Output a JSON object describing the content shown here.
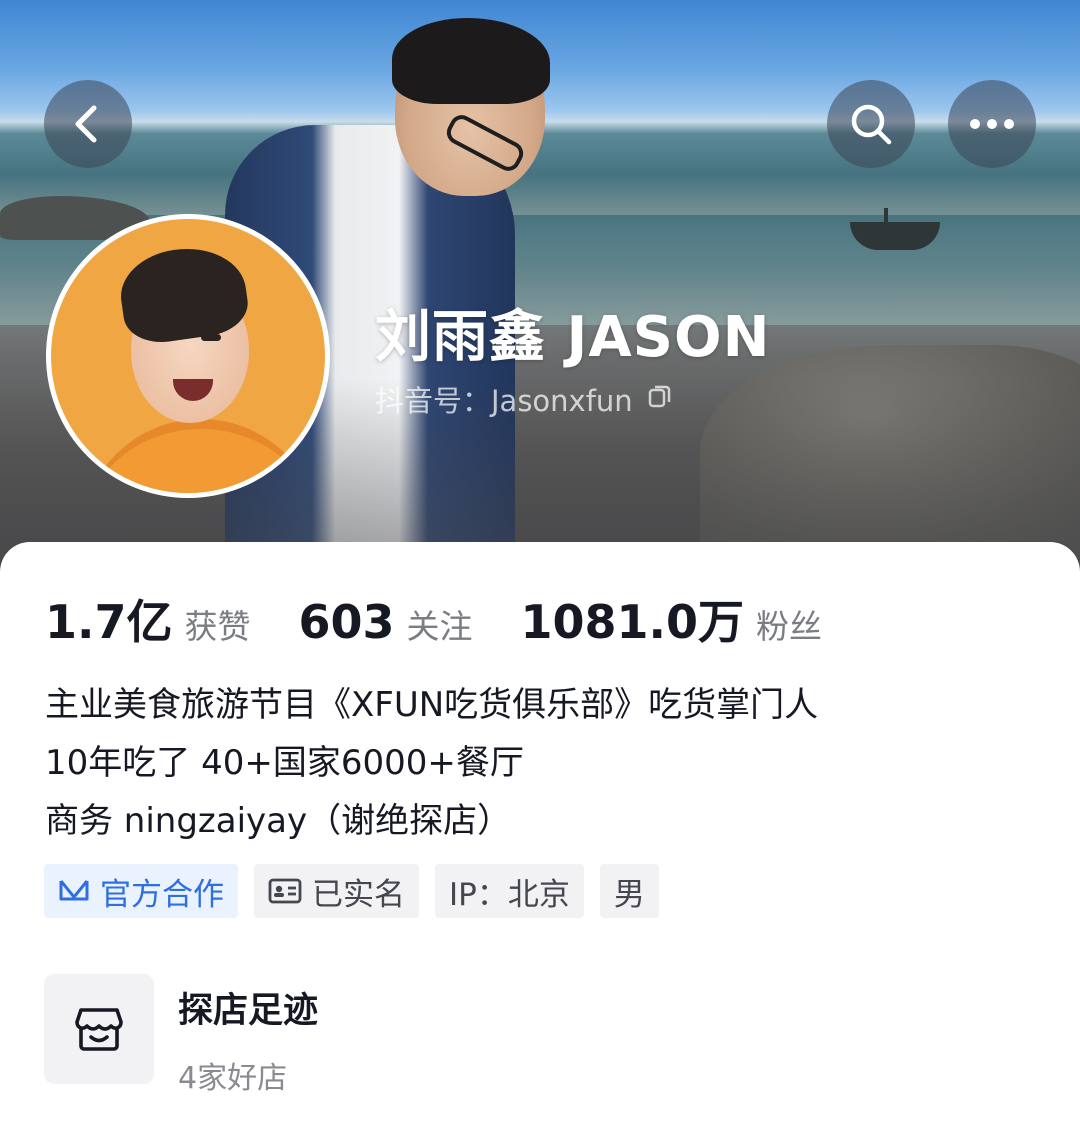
{
  "header": {
    "name": "刘雨鑫 JASON",
    "douyin_id": "抖音号：Jasonxfun",
    "back_icon": "chevron-left-icon",
    "search_icon": "search-icon",
    "more_icon": "more-horizontal-icon"
  },
  "stats": [
    {
      "value": "1.7亿",
      "label": "获赞"
    },
    {
      "value": "603",
      "label": "关注"
    },
    {
      "value": "1081.0万",
      "label": "粉丝"
    }
  ],
  "bio": [
    "主业美食旅游节目《XFUN吃货俱乐部》吃货掌门人",
    "10年吃了 40+国家6000+餐厅",
    "商务 ningzaiyay（谢绝探店）"
  ],
  "tags": {
    "official": "官方合作",
    "verified": "已实名",
    "ip": "IP：北京",
    "gender": "男"
  },
  "visit": {
    "title": "探店足迹",
    "subtitle": "4家好店"
  },
  "colors": {
    "accent_blue": "#2f6fe4",
    "text_primary": "#161823",
    "text_secondary": "#7b7d84",
    "tag_bg": "#f2f2f4"
  }
}
